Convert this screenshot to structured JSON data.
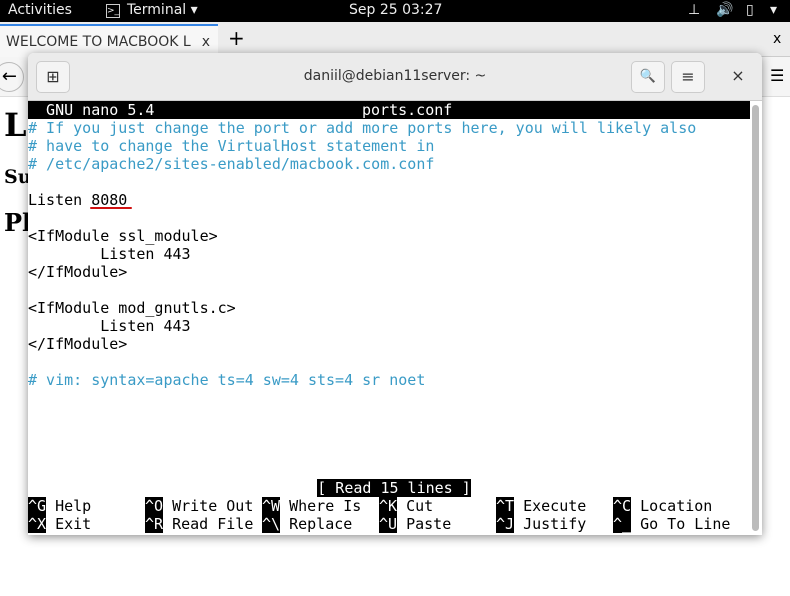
{
  "topbar": {
    "activities": "Activities",
    "app": "Terminal ▾",
    "clock": "Sep 25  03:27"
  },
  "browser": {
    "tab_title": "WELCOME TO MACBOOK L",
    "tab_close": "x",
    "new_tab": "+",
    "close": "x",
    "back": "←",
    "menu": "☰",
    "page_headings": [
      "L",
      "Su",
      "Pl"
    ]
  },
  "terminal": {
    "title": "daniil@debian11server: ~",
    "new_tab_icon": "⊞",
    "search_icon": "🔍",
    "menu_icon": "≡",
    "close_icon": "×"
  },
  "nano": {
    "version": "  GNU nano 5.4",
    "filename": "ports.conf",
    "lines": [
      {
        "text": "# If you just change the port or add more ports here, you will likely also",
        "comment": true
      },
      {
        "text": "# have to change the VirtualHost statement in",
        "comment": true
      },
      {
        "text": "# /etc/apache2/sites-enabled/macbook.com.conf",
        "comment": true
      },
      {
        "text": "",
        "comment": false
      },
      {
        "text": "Listen 8080",
        "comment": false
      },
      {
        "text": "",
        "comment": false
      },
      {
        "text": "<IfModule ssl_module>",
        "comment": false
      },
      {
        "text": "        Listen 443",
        "comment": false
      },
      {
        "text": "</IfModule>",
        "comment": false
      },
      {
        "text": "",
        "comment": false
      },
      {
        "text": "<IfModule mod_gnutls.c>",
        "comment": false
      },
      {
        "text": "        Listen 443",
        "comment": false
      },
      {
        "text": "</IfModule>",
        "comment": false
      },
      {
        "text": "",
        "comment": false
      },
      {
        "text": "# vim: syntax=apache ts=4 sw=4 sts=4 sr noet",
        "comment": true
      }
    ],
    "status": "[ Read 15 lines ]",
    "shortcuts": [
      [
        {
          "key": "^G",
          "label": "Help"
        },
        {
          "key": "^O",
          "label": "Write Out"
        },
        {
          "key": "^W",
          "label": "Where Is"
        },
        {
          "key": "^K",
          "label": "Cut"
        },
        {
          "key": "^T",
          "label": "Execute"
        },
        {
          "key": "^C",
          "label": "Location"
        }
      ],
      [
        {
          "key": "^X",
          "label": "Exit"
        },
        {
          "key": "^R",
          "label": "Read File"
        },
        {
          "key": "^\\",
          "label": "Replace"
        },
        {
          "key": "^U",
          "label": "Paste"
        },
        {
          "key": "^J",
          "label": "Justify"
        },
        {
          "key": "^_",
          "label": "Go To Line"
        }
      ]
    ]
  }
}
